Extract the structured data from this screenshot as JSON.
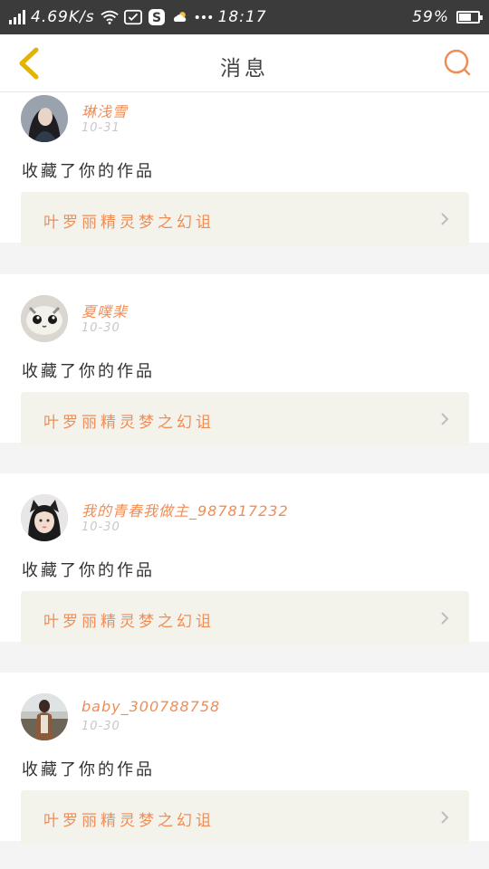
{
  "status_bar": {
    "speed": "4.69K/s",
    "time": "18:17",
    "battery": "59%",
    "battery_level": 0.59,
    "icons": [
      "signal-icon",
      "wifi-icon",
      "wechat-icon",
      "app-s-icon",
      "weather-icon",
      "more-dots-icon",
      "battery-icon"
    ]
  },
  "header": {
    "title": "消息",
    "back_icon": "chevron-left-icon",
    "search_icon": "search-icon"
  },
  "colors": {
    "accent": "#f08d56",
    "back_arrow": "#e0b400",
    "work_bg": "#f3f3ec"
  },
  "messages": [
    {
      "username": "琳浅雪",
      "date": "10-31",
      "action": "收藏了你的作品",
      "work_title": "叶罗丽精灵梦之幻诅",
      "avatar": "avatar-girl-dark"
    },
    {
      "username": "夏噗棐",
      "date": "10-30",
      "action": "收藏了你的作品",
      "work_title": "叶罗丽精灵梦之幻诅",
      "avatar": "avatar-cartoon-cat"
    },
    {
      "username": "我的青春我做主_987817232",
      "date": "10-30",
      "action": "收藏了你的作品",
      "work_title": "叶罗丽精灵梦之幻诅",
      "avatar": "avatar-cat-ears-girl"
    },
    {
      "username": "baby_300788758",
      "date": "10-30",
      "action": "收藏了你的作品",
      "work_title": "叶罗丽精灵梦之幻诅",
      "avatar": "avatar-person-outdoor"
    }
  ]
}
